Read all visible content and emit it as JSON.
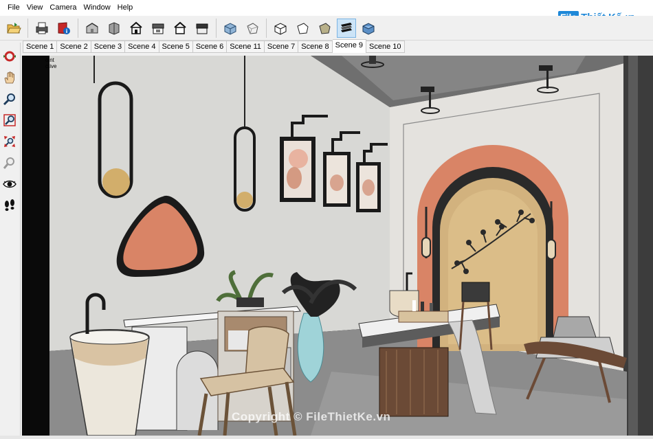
{
  "menu": [
    "File",
    "View",
    "Camera",
    "Window",
    "Help"
  ],
  "logo": {
    "badge": "File",
    "text": "Thiết Kế",
    "suffix": ".vn"
  },
  "toolbar": {
    "buttons": [
      {
        "name": "open-file-icon"
      },
      {
        "name": "print-icon"
      },
      {
        "name": "model-info-icon"
      },
      {
        "name": "iso-view-icon"
      },
      {
        "name": "top-view-icon"
      },
      {
        "name": "front-view-icon"
      },
      {
        "name": "right-view-icon"
      },
      {
        "name": "back-view-icon"
      },
      {
        "name": "left-view-icon"
      },
      {
        "name": "xray-style-icon"
      },
      {
        "name": "wireframe-style-icon"
      },
      {
        "name": "hidden-line-style-icon"
      },
      {
        "name": "shaded-style-icon"
      },
      {
        "name": "shaded-textures-style-icon"
      },
      {
        "name": "monochrome-style-icon"
      }
    ],
    "active_index": 13
  },
  "scenes": [
    "Scene 1",
    "Scene 2",
    "Scene 3",
    "Scene 4",
    "Scene 5",
    "Scene 6",
    "Scene 11",
    "Scene 7",
    "Scene 8",
    "Scene 9",
    "Scene 10"
  ],
  "active_scene": "Scene 9",
  "palette": [
    {
      "name": "orbit-icon"
    },
    {
      "name": "pan-icon"
    },
    {
      "name": "zoom-icon"
    },
    {
      "name": "zoom-window-icon"
    },
    {
      "name": "zoom-extents-icon"
    },
    {
      "name": "previous-view-icon"
    },
    {
      "name": "look-around-icon"
    },
    {
      "name": "walk-icon"
    }
  ],
  "viewport": {
    "label_line1": "oint",
    "label_line2": "ctive",
    "watermark": "Copyright © FileThietKe.vn"
  },
  "colors": {
    "accent": "#1e88d8",
    "terracotta": "#d98466",
    "wall": "#d9d9d6",
    "floor": "#8e8e8e"
  }
}
